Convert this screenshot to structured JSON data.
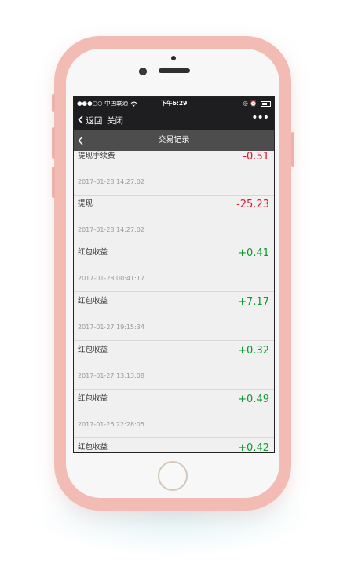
{
  "status_bar": {
    "carrier": "中国联通",
    "time": "下午6:29"
  },
  "nav": {
    "back_label": "返回",
    "close_label": "关闭",
    "more_label": "•••"
  },
  "page": {
    "title": "交易记录"
  },
  "transactions": [
    {
      "title": "提现手续费",
      "amount": "-0.51",
      "date": "2017-01-28  14:27:02",
      "sign": "neg"
    },
    {
      "title": "提现",
      "amount": "-25.23",
      "date": "2017-01-28  14:27:02",
      "sign": "neg"
    },
    {
      "title": "红包收益",
      "amount": "+0.41",
      "date": "2017-01-28  00:41:17",
      "sign": "pos"
    },
    {
      "title": "红包收益",
      "amount": "+7.17",
      "date": "2017-01-27  19:15:34",
      "sign": "pos"
    },
    {
      "title": "红包收益",
      "amount": "+0.32",
      "date": "2017-01-27  13:13:08",
      "sign": "pos"
    },
    {
      "title": "红包收益",
      "amount": "+0.49",
      "date": "2017-01-26  22:28:05",
      "sign": "pos"
    },
    {
      "title": "红包收益",
      "amount": "+0.42",
      "date": "",
      "sign": "pos"
    }
  ],
  "colors": {
    "negative": "#e0162b",
    "positive": "#0a9a2e",
    "phone_shell": "#f2bcb4"
  },
  "icons": [
    "signal-icon",
    "wifi-icon",
    "battery-icon",
    "alarm-icon",
    "back-chevron-icon"
  ]
}
